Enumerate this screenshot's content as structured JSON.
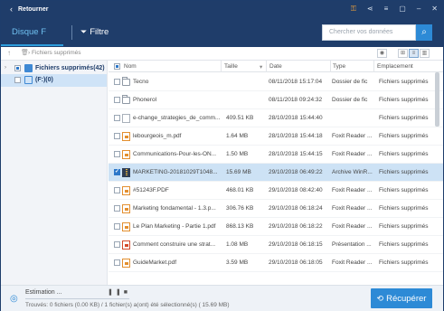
{
  "titlebar": {
    "back_label": "Retourner",
    "icons": [
      "key-icon",
      "share-icon",
      "menu-icon",
      "restore-icon",
      "minimize-icon",
      "close-icon"
    ]
  },
  "toolbar": {
    "disk_tab": "Disque F",
    "filter_label": "Filtre",
    "search_placeholder": "Chercher vos données"
  },
  "breadcrumb": {
    "path": "Fichiers supprimés"
  },
  "tree": [
    {
      "label": "Fichiers supprimés(42)",
      "checked": "partial"
    },
    {
      "label": "(F:)(0)",
      "checked": "none"
    }
  ],
  "columns": {
    "name": "Nom",
    "size": "Taille",
    "date": "Date",
    "type": "Type",
    "location": "Emplacement"
  },
  "files": [
    {
      "name": "Tecno",
      "size": "",
      "date": "08/11/2018 15:17:04",
      "type": "Dossier de fic",
      "location": "Fichiers supprimés",
      "icon": "folder",
      "checked": false
    },
    {
      "name": "Phonerol",
      "size": "",
      "date": "08/11/2018 09:24:32",
      "type": "Dossier de fic",
      "location": "Fichiers supprimés",
      "icon": "folder",
      "checked": false
    },
    {
      "name": "e-change_strategies_de_comm...",
      "size": "409.51 KB",
      "date": "28/10/2018 15:44:40",
      "type": "",
      "location": "Fichiers supprimés",
      "icon": "doc",
      "checked": false
    },
    {
      "name": "lebourgeois_m.pdf",
      "size": "1.64 MB",
      "date": "28/10/2018 15:44:18",
      "type": "Foxit Reader ...",
      "location": "Fichiers supprimés",
      "icon": "pdf",
      "checked": false
    },
    {
      "name": "Communications-Pour-les-ON...",
      "size": "1.50 MB",
      "date": "28/10/2018 15:44:15",
      "type": "Foxit Reader ...",
      "location": "Fichiers supprimés",
      "icon": "pdf",
      "checked": false
    },
    {
      "name": "MARKETING-20181029T1048...",
      "size": "15.69 MB",
      "date": "29/10/2018 06:49:22",
      "type": "Archive WinR...",
      "location": "Fichiers supprimés",
      "icon": "arch",
      "checked": true
    },
    {
      "name": "#51243F.PDF",
      "size": "468.01 KB",
      "date": "29/10/2018 08:42:40",
      "type": "Foxit Reader ...",
      "location": "Fichiers supprimés",
      "icon": "pdf",
      "checked": false
    },
    {
      "name": "Marketing fondamental - 1.3.p...",
      "size": "306.76 KB",
      "date": "29/10/2018 06:18:24",
      "type": "Foxit Reader ...",
      "location": "Fichiers supprimés",
      "icon": "pdf",
      "checked": false
    },
    {
      "name": "Le Plan Marketing - Partie 1.pdf",
      "size": "868.13 KB",
      "date": "29/10/2018 06:18:22",
      "type": "Foxit Reader ...",
      "location": "Fichiers supprimés",
      "icon": "pdf",
      "checked": false
    },
    {
      "name": "Comment construire une strat...",
      "size": "1.08 MB",
      "date": "29/10/2018 06:18:15",
      "type": "Présentation ...",
      "location": "Fichiers supprimés",
      "icon": "ppt",
      "checked": false
    },
    {
      "name": "GuideMarket.pdf",
      "size": "3.59 MB",
      "date": "29/10/2018 06:18:05",
      "type": "Foxit Reader ...",
      "location": "Fichiers supprimés",
      "icon": "pdf",
      "checked": false
    }
  ],
  "status": {
    "estimation_label": "Estimation ...",
    "found_text": "Trouvés: 0 fichiers (0.00 KB) / 1 fichier(s) a(ont) été sélectionné(s) ( 15.69 MB)",
    "recover_label": "Récupérer"
  },
  "colors": {
    "titlebar_bg": "#1f3d6a",
    "accent": "#2d8ad6",
    "selected_row": "#cde2f5"
  }
}
